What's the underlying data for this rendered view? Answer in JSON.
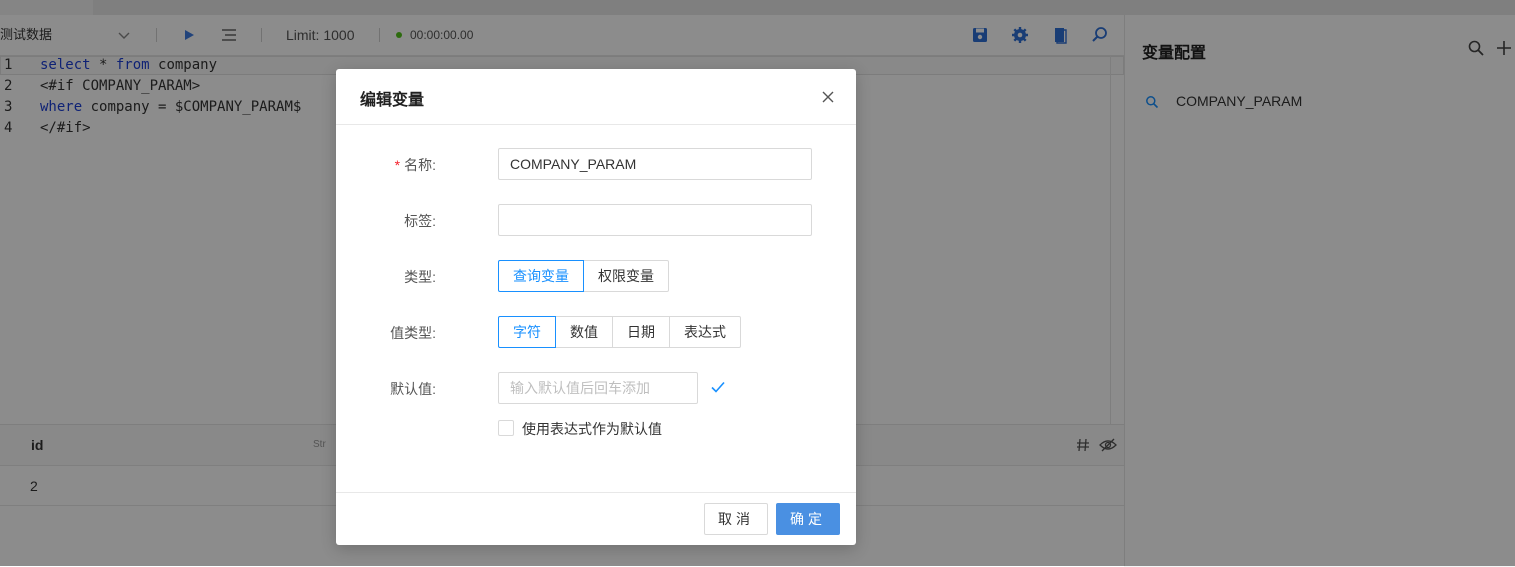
{
  "toolbar": {
    "datasource": "测试数据",
    "limit": "Limit: 1000",
    "timer": "00:00:00.00"
  },
  "editor": {
    "lines": [
      {
        "no": "1",
        "parts": [
          {
            "t": "select",
            "k": true
          },
          {
            "t": " * ",
            "k": false
          },
          {
            "t": "from",
            "k": true
          },
          {
            "t": " company",
            "k": false
          }
        ]
      },
      {
        "no": "2",
        "parts": [
          {
            "t": "<#if COMPANY_PARAM>",
            "k": false
          }
        ]
      },
      {
        "no": "3",
        "parts": [
          {
            "t": "where",
            "k": true
          },
          {
            "t": " company = $COMPANY_PARAM$",
            "k": false
          }
        ]
      },
      {
        "no": "4",
        "parts": [
          {
            "t": "</#if>",
            "k": false
          }
        ]
      }
    ]
  },
  "results": {
    "column": "id",
    "column_type": "Str",
    "value": "2"
  },
  "panel": {
    "title": "变量配置",
    "items": [
      "COMPANY_PARAM"
    ]
  },
  "modal": {
    "title": "编辑变量",
    "name_label": "名称:",
    "name_value": "COMPANY_PARAM",
    "tag_label": "标签:",
    "tag_value": "",
    "type_label": "类型:",
    "type_options": [
      "查询变量",
      "权限变量"
    ],
    "type_selected": 0,
    "value_type_label": "值类型:",
    "value_type_options": [
      "字符",
      "数值",
      "日期",
      "表达式"
    ],
    "value_type_selected": 0,
    "default_label": "默认值:",
    "default_placeholder": "输入默认值后回车添加",
    "expr_checkbox_label": "使用表达式作为默认值",
    "cancel": "取消",
    "ok": "确定"
  },
  "colors": {
    "primary": "#1890ff",
    "ok_button": "#4a90e2",
    "keyword": "#1c3fd6",
    "status_dot": "#52c41a"
  }
}
